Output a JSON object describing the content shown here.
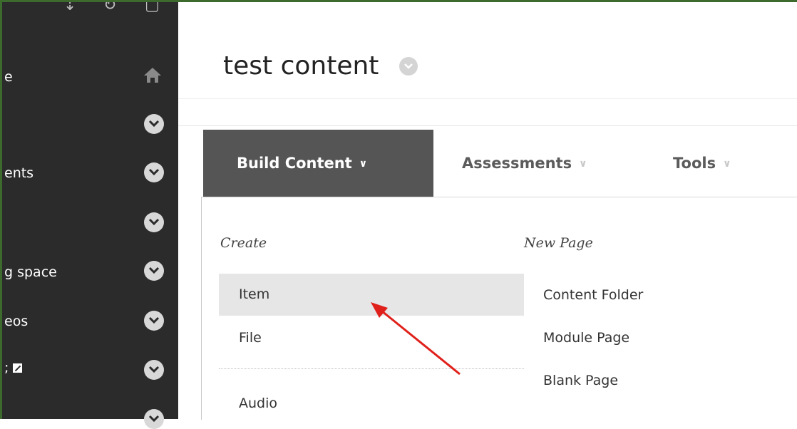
{
  "sidebar": {
    "items": [
      {
        "label": "e",
        "icon": "home-icon"
      },
      {
        "label": "",
        "icon": "chevron-down-icon"
      },
      {
        "label": "ents",
        "icon": "chevron-down-icon"
      },
      {
        "label": "",
        "icon": "chevron-down-icon"
      },
      {
        "label": "g space",
        "icon": "chevron-down-icon"
      },
      {
        "label": "eos",
        "icon": "chevron-down-icon"
      },
      {
        "label": ";",
        "icon": "chevron-down-icon"
      }
    ]
  },
  "page": {
    "title": "test content"
  },
  "tabs": [
    {
      "label": "Build Content",
      "active": true
    },
    {
      "label": "Assessments",
      "active": false
    },
    {
      "label": "Tools",
      "active": false
    }
  ],
  "dropdown": {
    "create_heading": "Create",
    "new_page_heading": "New Page",
    "create_items": [
      "Item",
      "File",
      "Audio"
    ],
    "new_page_items": [
      "Content Folder",
      "Module Page",
      "Blank Page"
    ],
    "highlighted_item": "Item"
  },
  "annotation": {
    "arrow_color": "#e0201b"
  },
  "colors": {
    "sidebar_bg": "#2b2b2b",
    "active_tab_bg": "#555555",
    "frame_border": "#3d6b2e"
  }
}
